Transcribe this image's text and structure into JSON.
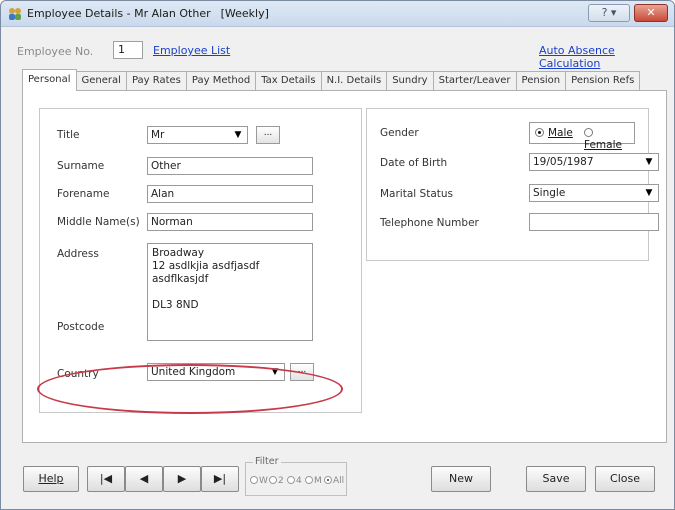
{
  "window": {
    "title": "Employee Details - Mr Alan Other",
    "mode": "[Weekly]",
    "help_label": "? ▾",
    "close_label": "✕"
  },
  "header": {
    "employee_no_label": "Employee No.",
    "employee_no_value": "1",
    "employee_list_link": "Employee List",
    "auto_absence_link": "Auto Absence Calculation"
  },
  "tabs": [
    {
      "label": "Personal",
      "active": true
    },
    {
      "label": "General"
    },
    {
      "label": "Pay Rates"
    },
    {
      "label": "Pay Method"
    },
    {
      "label": "Tax Details"
    },
    {
      "label": "N.I. Details"
    },
    {
      "label": "Sundry"
    },
    {
      "label": "Starter/Leaver"
    },
    {
      "label": "Pension"
    },
    {
      "label": "Pension Refs"
    }
  ],
  "personal": {
    "title_label": "Title",
    "title_value": "Mr",
    "surname_label": "Surname",
    "surname_value": "Other",
    "forename_label": "Forename",
    "forename_value": "Alan",
    "middle_label": "Middle Name(s)",
    "middle_value": "Norman",
    "address_label": "Address",
    "address_lines": [
      "Broadway",
      "12 asdlkjia asdfjasdf",
      "asdflkasjdf"
    ],
    "postcode_label": "Postcode",
    "postcode_value": "DL3 8ND",
    "country_label": "Country",
    "country_value": "United Kingdom",
    "dots_label": "...",
    "gender_label": "Gender",
    "gender_male": "Male",
    "gender_female": "Female",
    "gender_selected": "Male",
    "dob_label": "Date of Birth",
    "dob_value": "19/05/1987",
    "marital_label": "Marital Status",
    "marital_value": "Single",
    "phone_label": "Telephone Number",
    "phone_value": ""
  },
  "footer": {
    "help_button": "Help",
    "nav_first": "|◀",
    "nav_prev": "◀",
    "nav_next": "▶",
    "nav_last": "▶|",
    "filter_label": "Filter",
    "filter_options": [
      "W",
      "2",
      "4",
      "M",
      "All"
    ],
    "filter_selected": "All",
    "new_button": "New",
    "save_button": "Save",
    "close_button": "Close"
  },
  "colors": {
    "highlight": "#c83a4a",
    "link": "#1a3fc7"
  }
}
